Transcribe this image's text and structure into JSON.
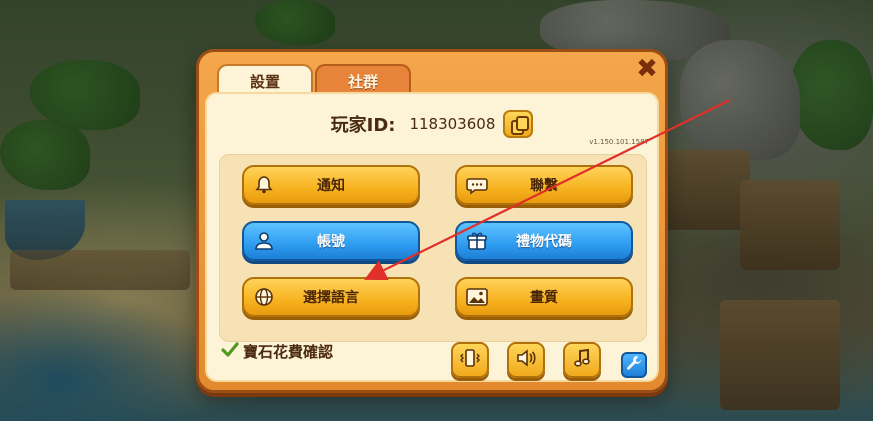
{
  "tabs": [
    {
      "label": "設置",
      "active": true
    },
    {
      "label": "社群",
      "active": false
    }
  ],
  "close_icon": "close-x-icon",
  "player": {
    "label": "玩家ID:",
    "id": "118303608",
    "copy_icon": "copy-icon"
  },
  "version": "v1.150.101.1587",
  "menu": [
    {
      "label": "通知",
      "icon": "bell-icon",
      "style": "gold"
    },
    {
      "label": "聯繫",
      "icon": "chat-icon",
      "style": "gold"
    },
    {
      "label": "帳號",
      "icon": "user-icon",
      "style": "blue"
    },
    {
      "label": "禮物代碼",
      "icon": "gift-icon",
      "style": "blue"
    },
    {
      "label": "選擇語言",
      "icon": "globe-icon",
      "style": "gold"
    },
    {
      "label": "畫質",
      "icon": "image-icon",
      "style": "gold"
    }
  ],
  "gem_confirm": {
    "label": "寶石花費確認",
    "checked": true
  },
  "toggles": [
    {
      "name": "vibration",
      "icon": "vibration-icon"
    },
    {
      "name": "sound",
      "icon": "speaker-icon"
    },
    {
      "name": "music",
      "icon": "music-note-icon"
    }
  ],
  "settings_tool_icon": "wrench-icon",
  "annotation_color": "#e0302a",
  "colors": {
    "gold": "#f7b21f",
    "blue": "#2e9cf0",
    "panel": "#fdf3d6",
    "frame": "#e38a2e"
  }
}
